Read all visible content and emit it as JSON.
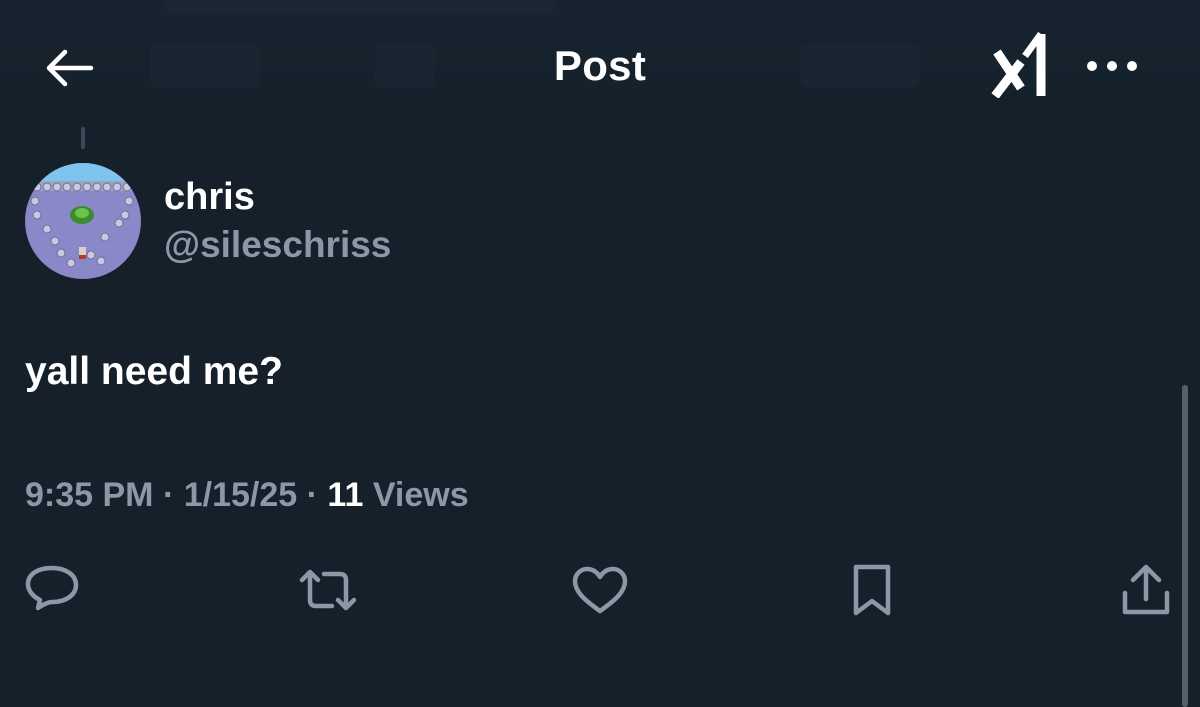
{
  "header": {
    "title": "Post",
    "back_icon": "arrow-left-icon",
    "grok_icon": "grok-logo-icon",
    "more_icon": "more-horizontal-icon"
  },
  "post": {
    "author": {
      "display_name": "chris",
      "handle": "@sileschriss"
    },
    "text": "yall need me?",
    "time": "9:35 PM",
    "date": "1/15/25",
    "separator": "·",
    "views_count": "11",
    "views_label": "Views"
  },
  "actions": [
    {
      "name": "reply",
      "icon": "reply-icon"
    },
    {
      "name": "repost",
      "icon": "repost-icon"
    },
    {
      "name": "like",
      "icon": "heart-icon"
    },
    {
      "name": "bookmark",
      "icon": "bookmark-icon"
    },
    {
      "name": "share",
      "icon": "share-icon"
    }
  ],
  "colors": {
    "background": "#15202b",
    "primary_text": "#ffffff",
    "secondary_text": "#8b98a5",
    "icon": "#8b98a5"
  }
}
